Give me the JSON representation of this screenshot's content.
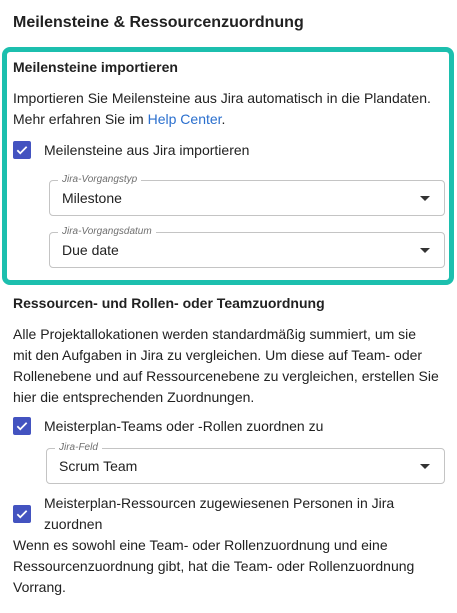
{
  "page": {
    "title": "Meilensteine & Ressourcenzuordnung"
  },
  "milestones": {
    "title": "Meilensteine importieren",
    "description_line1": "Importieren Sie Meilensteine aus Jira automatisch in die Plandaten.",
    "description_line2_prefix": "Mehr erfahren Sie im ",
    "help_link": "Help Center",
    "description_line2_suffix": ".",
    "checkbox_label": "Meilensteine aus Jira importieren",
    "checkbox_checked": true,
    "issue_type": {
      "label": "Jira-Vorgangstyp",
      "value": "Milestone"
    },
    "issue_date": {
      "label": "Jira-Vorgangsdatum",
      "value": "Due date"
    }
  },
  "resources": {
    "title": "Ressourcen- und Rollen- oder Teamzuordnung",
    "description": [
      "Alle Projektallokationen werden standardmäßig summiert, um sie",
      "mit den Aufgaben in Jira zu vergleichen. Um diese auf Team- oder",
      "Rollenebene und auf Ressourcenebene zu vergleichen, erstellen Sie",
      "hier die entsprechenden Zuordnungen."
    ],
    "team_checkbox_label": "Meisterplan-Teams oder -Rollen zuordnen zu",
    "team_checkbox_checked": true,
    "jira_field": {
      "label": "Jira-Feld",
      "value": "Scrum Team"
    },
    "person_checkbox_label_line1": "Meisterplan-Ressourcen zugewiesenen Personen in Jira",
    "person_checkbox_label_line2": "zuordnen",
    "person_checkbox_checked": true,
    "note": [
      "Wenn es sowohl eine Team- oder Rollenzuordnung und eine",
      "Ressourcenzuordnung gibt, hat die Team- oder Rollenzuordnung",
      "Vorrang."
    ]
  },
  "colors": {
    "accent": "#4353c0",
    "highlight": "#1cbfae",
    "link": "#2a6fce"
  }
}
